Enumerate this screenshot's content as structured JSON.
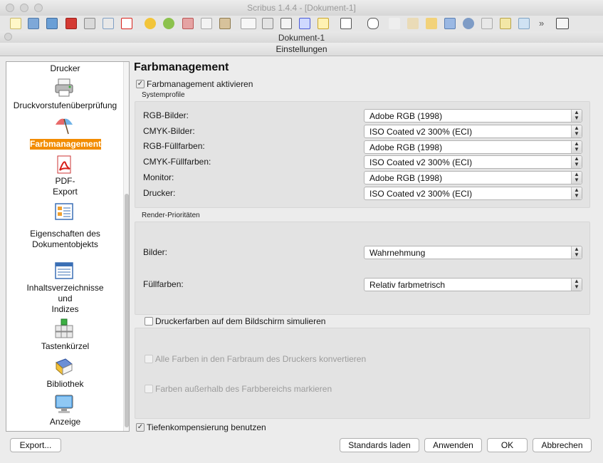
{
  "app_window": {
    "title": "Scribus 1.4.4 - [Dokument-1]"
  },
  "document_window": {
    "title": "Dokument-1"
  },
  "dialog": {
    "title": "Einstellungen"
  },
  "sidebar": {
    "items": [
      {
        "label": "Drucker",
        "icon": "printer-icon"
      },
      {
        "label": "Druckvorstufenüberprüfung",
        "icon": "preflight-icon"
      },
      {
        "label": "Farbmanagement",
        "icon": "color-umbrella-icon",
        "selected": true
      },
      {
        "label": "PDF-",
        "label2": "Export",
        "icon": "pdf-icon"
      },
      {
        "label": "Eigenschaften des",
        "label2": "Dokumentobjekts",
        "icon": "document-items-icon"
      },
      {
        "label": "Inhaltsverzeichnisse",
        "label2": "und",
        "label3": "Indizes",
        "icon": "toc-icon"
      },
      {
        "label": "Tastenkürzel",
        "icon": "keyboard-icon"
      },
      {
        "label": "Bibliothek",
        "icon": "book-icon"
      },
      {
        "label": "Anzeige",
        "icon": "monitor-icon"
      }
    ]
  },
  "main": {
    "heading": "Farbmanagement",
    "activate": {
      "label": "Farbmanagement aktivieren",
      "checked": true
    },
    "system_profiles": {
      "title": "Systemprofile",
      "rows": [
        {
          "label": "RGB-Bilder:",
          "value": "Adobe RGB (1998)"
        },
        {
          "label": "CMYK-Bilder:",
          "value": "ISO Coated v2 300% (ECI)"
        },
        {
          "label": "RGB-Füllfarben:",
          "value": "Adobe RGB (1998)"
        },
        {
          "label": "CMYK-Füllfarben:",
          "value": "ISO Coated v2 300% (ECI)"
        },
        {
          "label": "Monitor:",
          "value": "Adobe RGB (1998)"
        },
        {
          "label": "Drucker:",
          "value": "ISO Coated v2 300% (ECI)"
        }
      ]
    },
    "render_priorities": {
      "title": "Render-Prioritäten",
      "rows": [
        {
          "label": "Bilder:",
          "value": "Wahrnehmung"
        },
        {
          "label": "Füllfarben:",
          "value": "Relativ farbmetrisch"
        }
      ]
    },
    "simulate": {
      "label": "Druckerfarben auf dem Bildschirm simulieren",
      "checked": false
    },
    "convert_all": {
      "label": "Alle Farben in den Farbraum des Druckers konvertieren",
      "checked": false,
      "disabled": true
    },
    "mark_out_of_gamut": {
      "label": "Farben außerhalb des Farbbereichs markieren",
      "checked": false,
      "disabled": true
    },
    "black_point": {
      "label": "Tiefenkompensierung benutzen",
      "checked": true
    }
  },
  "buttons": {
    "export": "Export...",
    "load_defaults": "Standards laden",
    "apply": "Anwenden",
    "ok": "OK",
    "cancel": "Abbrechen"
  },
  "colors": {
    "selection": "#f28c00",
    "pdf_red": "#d8201a"
  }
}
